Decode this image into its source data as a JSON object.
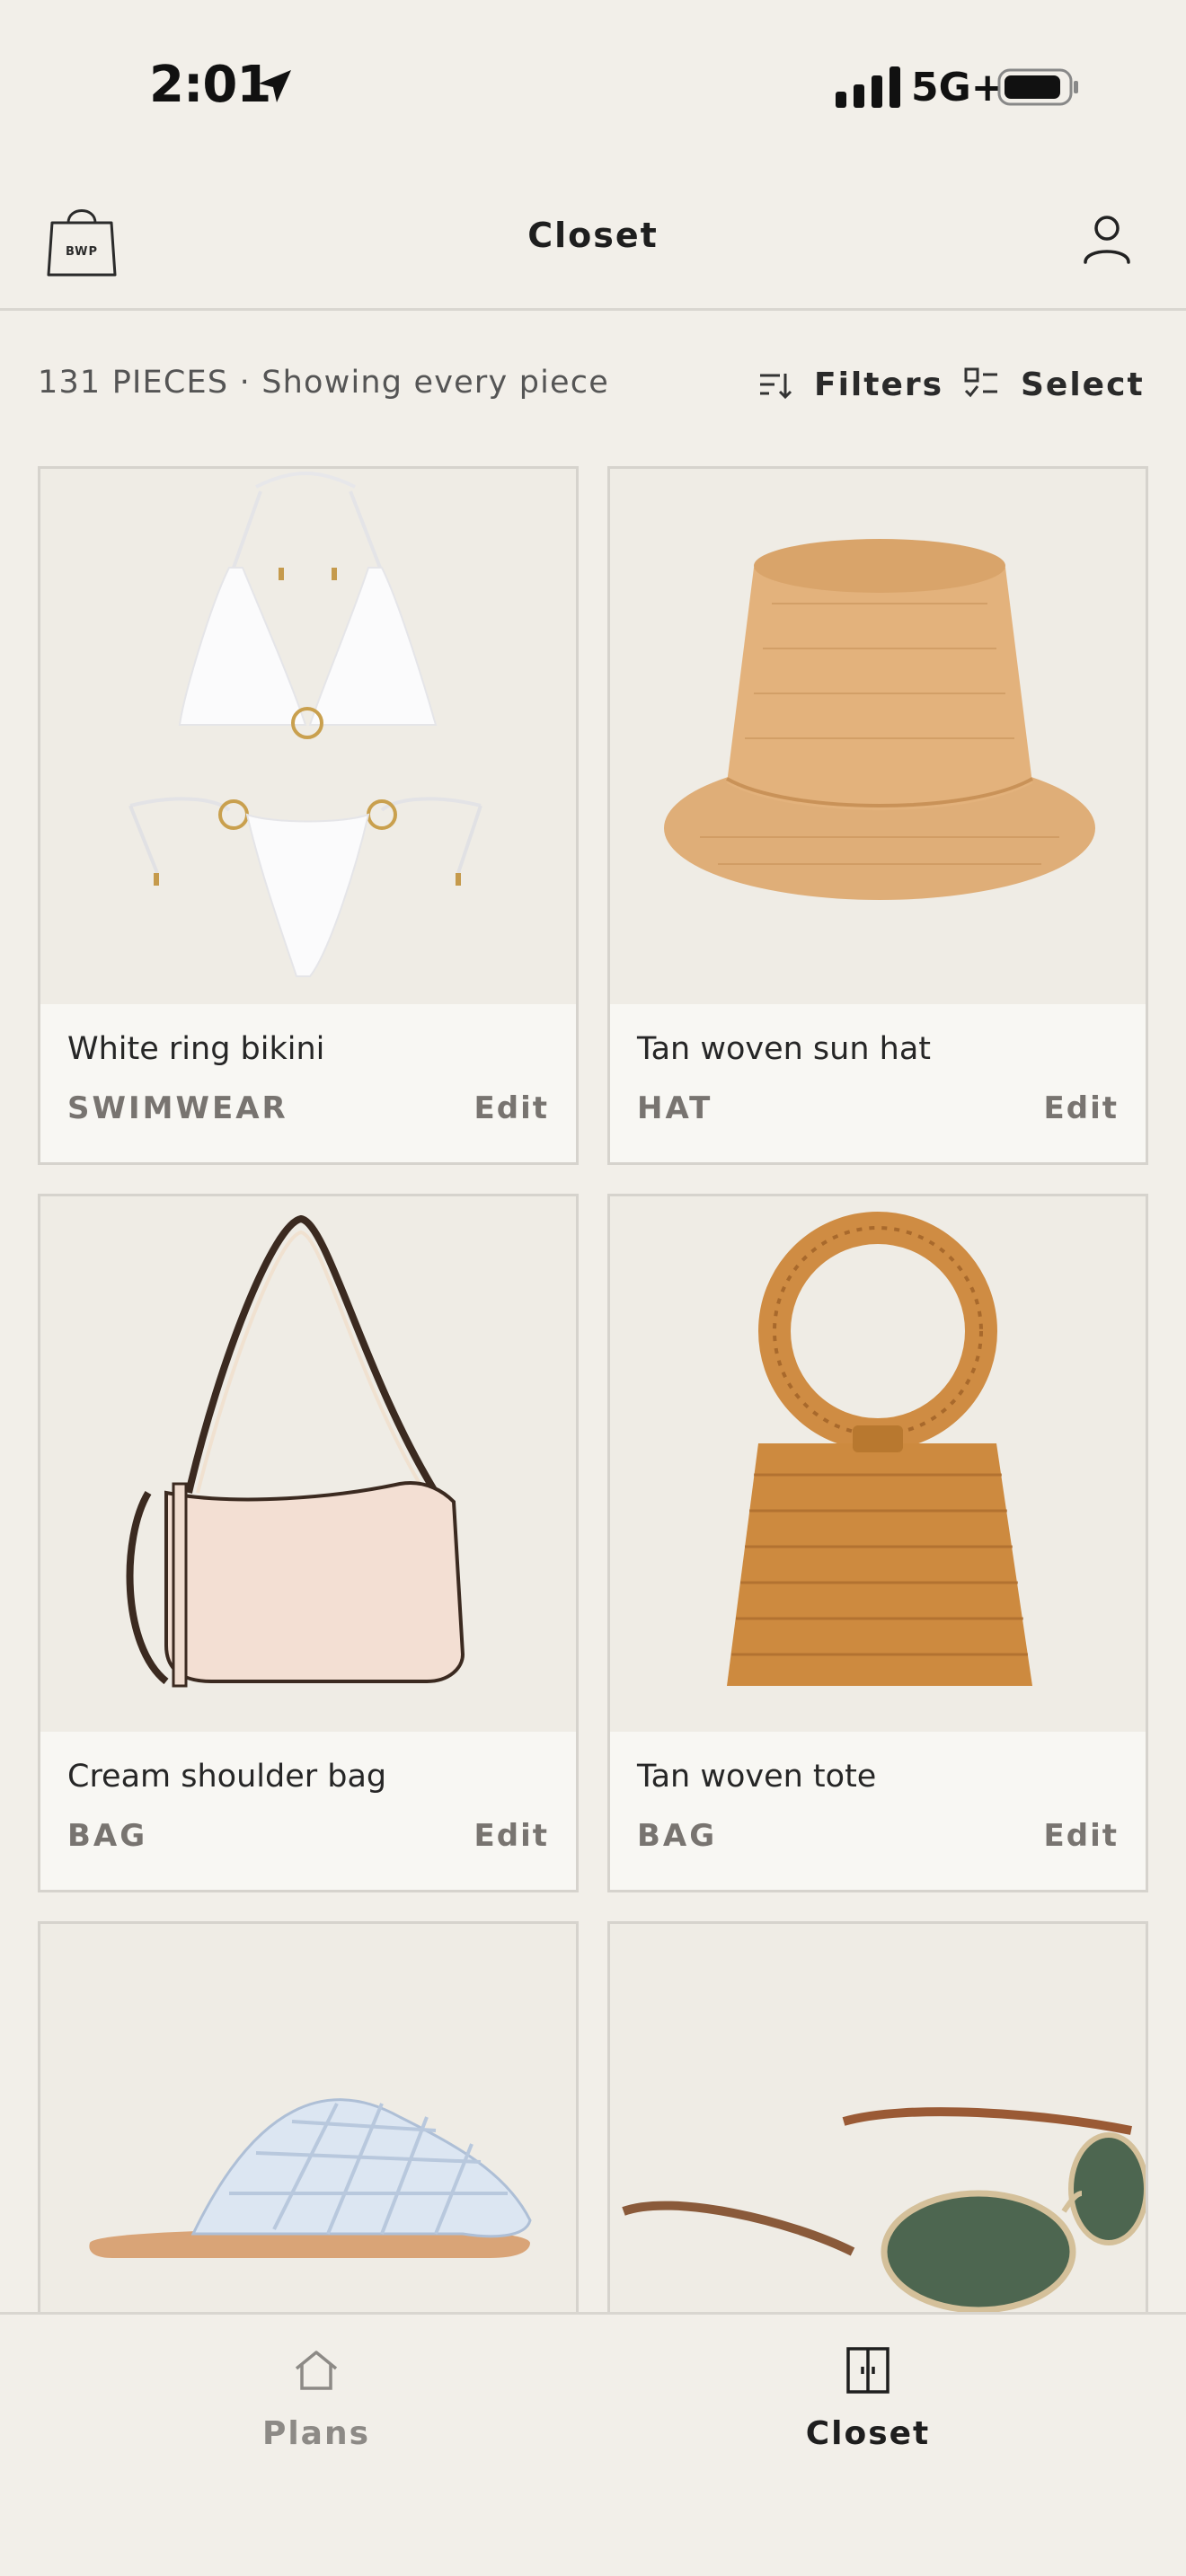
{
  "status_bar": {
    "time": "2:01",
    "network": "5G+"
  },
  "header": {
    "logo_text": "BWP",
    "title": "Closet"
  },
  "toolbar": {
    "summary": "131 PIECES · Showing every piece",
    "filters_label": "Filters",
    "select_label": "Select"
  },
  "items": [
    {
      "name": "White ring bikini",
      "category": "SWIMWEAR",
      "edit": "Edit",
      "image": "white-bikini-image"
    },
    {
      "name": "Tan woven sun hat",
      "category": "HAT",
      "edit": "Edit",
      "image": "straw-bucket-hat-image"
    },
    {
      "name": "Cream shoulder bag",
      "category": "BAG",
      "edit": "Edit",
      "image": "cream-shoulder-bag-image"
    },
    {
      "name": "Tan woven tote",
      "category": "BAG",
      "edit": "Edit",
      "image": "rattan-ring-handle-bag-image"
    },
    {
      "name": "",
      "category": "",
      "edit": "",
      "image": "mesh-flat-mule-image"
    },
    {
      "name": "",
      "category": "",
      "edit": "",
      "image": "oval-sunglasses-image"
    }
  ],
  "tabbar": {
    "tabs": [
      {
        "label": "Plans",
        "icon": "home-icon",
        "active": false
      },
      {
        "label": "Closet",
        "icon": "wardrobe-icon",
        "active": true
      }
    ]
  },
  "colors": {
    "background": "#f2efe9",
    "card_footer": "#f8f7f3",
    "active_tab": "#1e1e1e",
    "inactive_tab": "#8d8a86"
  }
}
